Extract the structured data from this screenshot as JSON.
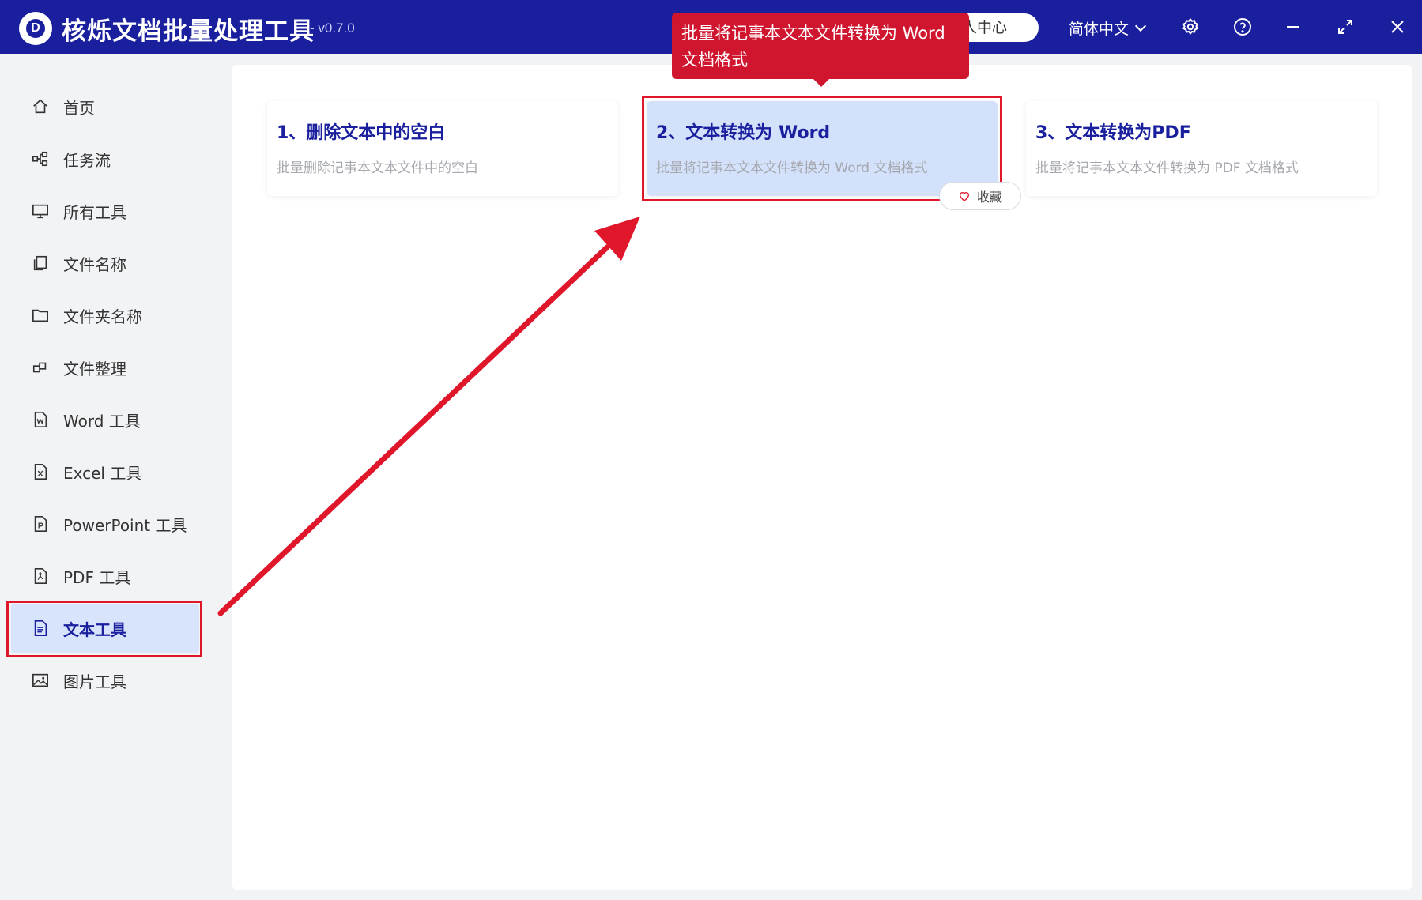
{
  "app": {
    "logo_letter": "D",
    "title": "核烁文档批量处理工具",
    "version": "- v0.7.0"
  },
  "header": {
    "user_center": "个人中心",
    "language": "简体中文"
  },
  "sidebar": {
    "items": [
      {
        "label": "首页",
        "icon": "home-icon"
      },
      {
        "label": "任务流",
        "icon": "workflow-icon"
      },
      {
        "label": "所有工具",
        "icon": "monitor-icon"
      },
      {
        "label": "文件名称",
        "icon": "file-copy-icon"
      },
      {
        "label": "文件夹名称",
        "icon": "folder-icon"
      },
      {
        "label": "文件整理",
        "icon": "organize-icon"
      },
      {
        "label": "Word 工具",
        "icon": "word-file-icon"
      },
      {
        "label": "Excel 工具",
        "icon": "excel-file-icon"
      },
      {
        "label": "PowerPoint 工具",
        "icon": "ppt-file-icon"
      },
      {
        "label": "PDF 工具",
        "icon": "pdf-file-icon"
      },
      {
        "label": "文本工具",
        "icon": "text-file-icon",
        "active": true
      },
      {
        "label": "图片工具",
        "icon": "image-icon"
      }
    ]
  },
  "tools": [
    {
      "title": "1、删除文本中的空白",
      "desc": "批量删除记事本文本文件中的空白"
    },
    {
      "title": "2、文本转换为 Word",
      "desc": "批量将记事本文本文件转换为 Word 文档格式",
      "active": true
    },
    {
      "title": "3、文本转换为PDF",
      "desc": "批量将记事本文本文件转换为 PDF 文档格式"
    }
  ],
  "favorite_label": "收藏",
  "tooltip": {
    "line1": "批量将记事本文本文件转换为 Word",
    "line2": "文档格式"
  },
  "colors": {
    "titlebar": "#1a1f9e",
    "active_bg": "#d3e1fb",
    "highlight_red": "#e0162b",
    "tooltip_red": "#d0152f"
  }
}
